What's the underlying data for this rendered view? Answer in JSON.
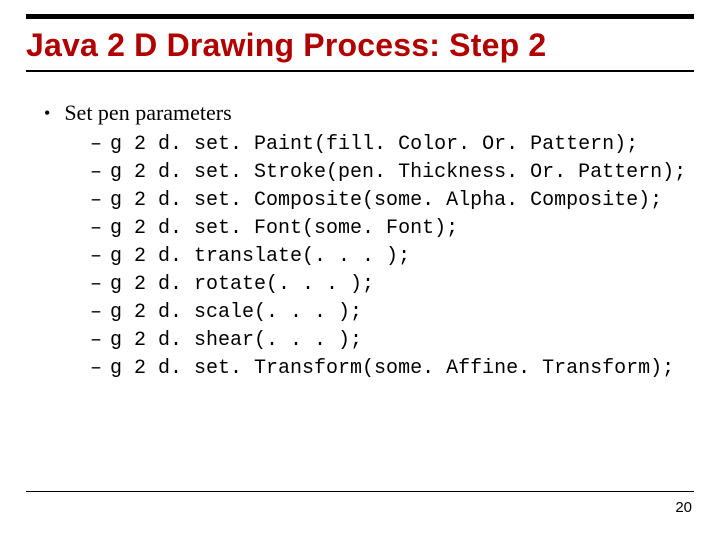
{
  "title": "Java 2 D Drawing Process: Step 2",
  "main_bullet": "Set pen parameters",
  "items": [
    "g 2 d. set. Paint(fill. Color. Or. Pattern);",
    "g 2 d. set. Stroke(pen. Thickness. Or. Pattern);",
    "g 2 d. set. Composite(some. Alpha. Composite);",
    "g 2 d. set. Font(some. Font);",
    "g 2 d. translate(. . . );",
    "g 2 d. rotate(. . . );",
    "g 2 d. scale(. . . );",
    "g 2 d. shear(. . . );",
    "g 2 d. set. Transform(some. Affine. Transform);"
  ],
  "page_number": "20"
}
